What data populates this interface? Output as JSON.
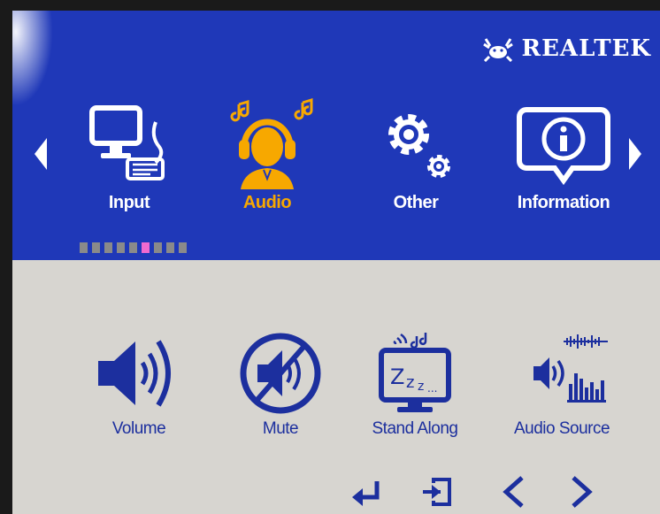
{
  "brand": {
    "name": "REALTEK"
  },
  "top_menu": {
    "items": [
      {
        "label": "Input",
        "icon": "monitor-keyboard-icon"
      },
      {
        "label": "Audio",
        "icon": "headphones-person-icon",
        "active": true
      },
      {
        "label": "Other",
        "icon": "gears-icon"
      },
      {
        "label": "Information",
        "icon": "info-bubble-icon"
      }
    ],
    "page_indicator": {
      "total": 9,
      "current": 6
    }
  },
  "audio_menu": {
    "items": [
      {
        "label": "Volume",
        "icon": "speaker-volume-icon"
      },
      {
        "label": "Mute",
        "icon": "speaker-mute-icon"
      },
      {
        "label": "Stand Along",
        "icon": "sleep-monitor-icon"
      },
      {
        "label": "Audio Source",
        "icon": "audio-source-icon"
      }
    ]
  },
  "nav_buttons": [
    "enter-icon",
    "exit-icon",
    "left-arrow-icon",
    "right-arrow-icon"
  ],
  "colors": {
    "header_blue": "#1f38b8",
    "panel_gray": "#d7d5d0",
    "active_orange": "#f7a800",
    "icon_blue": "#1c2f9e"
  }
}
